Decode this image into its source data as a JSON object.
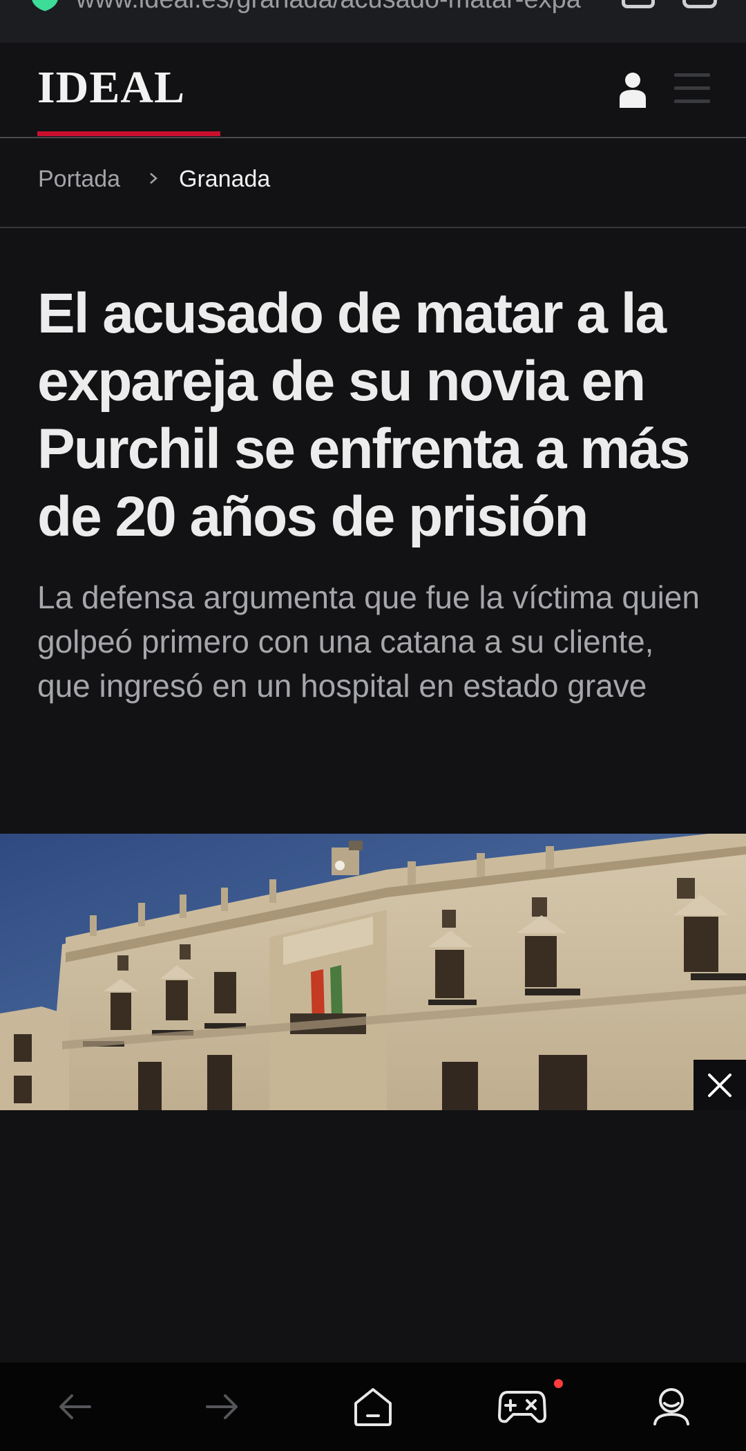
{
  "browser": {
    "url": "www.ideal.es/granada/acusado-matar-expa",
    "accent_color": "#3ddc97"
  },
  "site": {
    "logo": "IDEAL",
    "brand_color": "#c8102e"
  },
  "breadcrumb": {
    "home": "Portada",
    "current": "Granada"
  },
  "article": {
    "headline": "El acusado de matar a la expareja de su novia en Purchil se enfrenta a más de 20 años de prisión",
    "subtitle": "La defensa argumenta que fue la víctima quien golpeó primero con una catana a su cliente, que ingresó en un hospital en estado grave"
  },
  "bottom_nav": {
    "items": [
      "back-icon",
      "forward-icon",
      "home-icon",
      "games-icon",
      "profile-icon"
    ],
    "notification_color": "#ff3b3b"
  }
}
